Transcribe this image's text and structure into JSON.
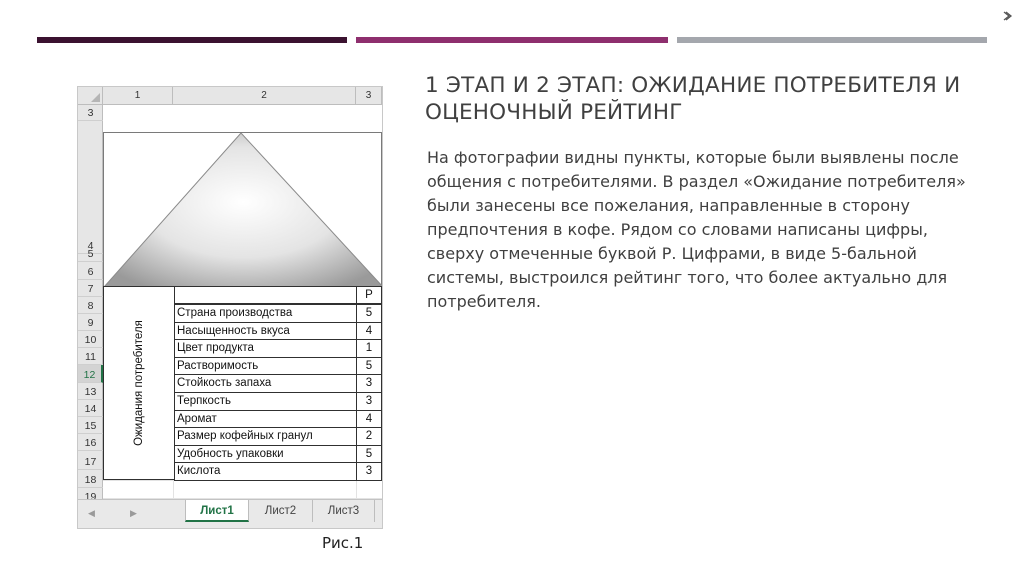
{
  "slide": {
    "title": "1 этап и 2 этап: Ожидание потребителя и оценочный рейтинг",
    "body": "На фотографии видны пункты, которые были выявлены после общения с потребителями. В раздел «Ожидание потребителя» были занесены все пожелания, направленные в сторону предпочтения в кофе. Рядом со словами написаны цифры, сверху отмеченные буквой Р. Цифрами, в виде 5-бальной системы, выстроился рейтинг того, что более актуально для потребителя.",
    "caption": "Рис.1",
    "bar_colors": [
      "#3b1230",
      "#8e2f6e",
      "#a4a7ad"
    ]
  },
  "spreadsheet": {
    "column_headers": [
      "1",
      "2",
      "3"
    ],
    "row_numbers": [
      "3",
      "4",
      "5",
      "6",
      "7",
      "8",
      "9",
      "10",
      "11",
      "12",
      "13",
      "14",
      "15",
      "16",
      "17",
      "18",
      "19"
    ],
    "selected_row": "12",
    "rating_header": "Р",
    "vertical_label": "Ожидания потребителя",
    "rows": [
      {
        "label": "Страна производства",
        "rating": "5"
      },
      {
        "label": "Насыщенность вкуса",
        "rating": "4"
      },
      {
        "label": "Цвет продукта",
        "rating": "1"
      },
      {
        "label": "Растворимость",
        "rating": "5"
      },
      {
        "label": "Стойкость запаха",
        "rating": "3"
      },
      {
        "label": "Терпкость",
        "rating": "3"
      },
      {
        "label": "Аромат",
        "rating": "4"
      },
      {
        "label": "Размер кофейных гранул",
        "rating": "2"
      },
      {
        "label": "Удобность упаковки",
        "rating": "5"
      },
      {
        "label": "Кислота",
        "rating": "3"
      }
    ],
    "sheet_tabs": [
      "Лист1",
      "Лист2",
      "Лист3"
    ],
    "active_tab": "Лист1",
    "accent_color": "#217346"
  }
}
